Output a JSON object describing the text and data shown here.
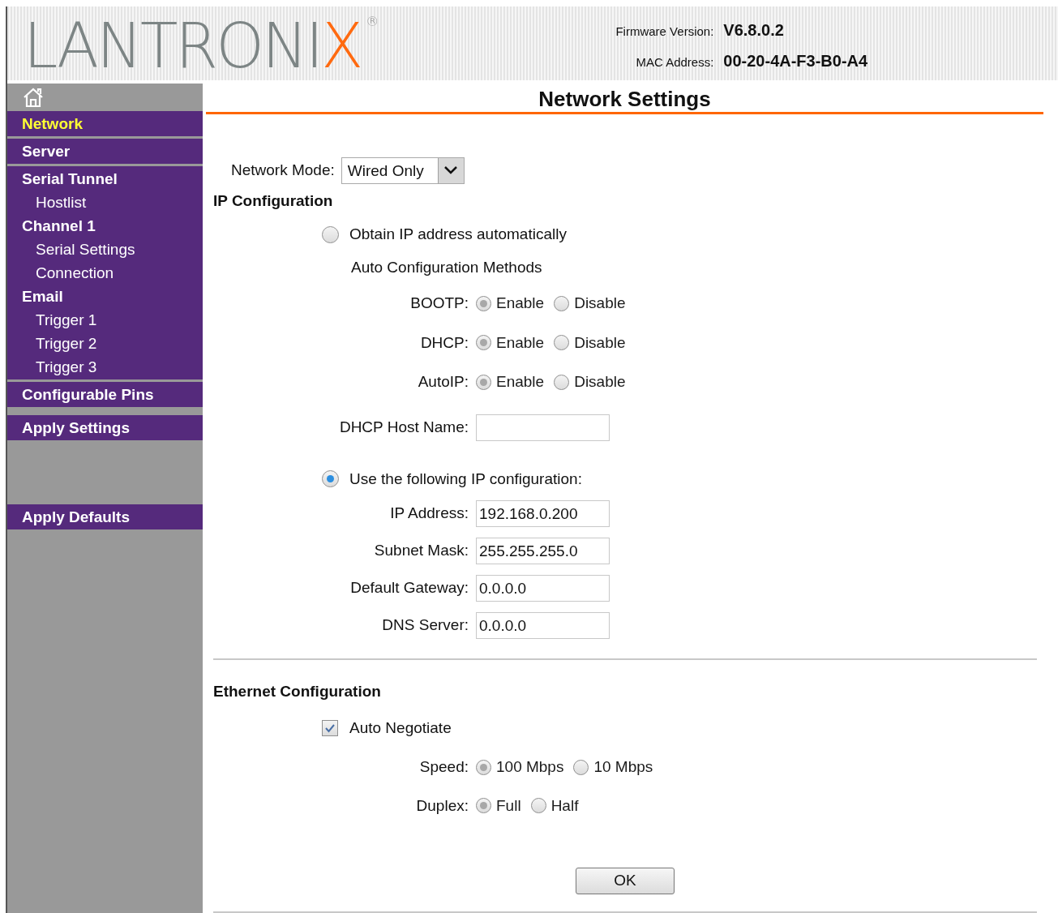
{
  "header": {
    "logo": {
      "main": "LANTRONI",
      "accent": "X",
      "mark": "®"
    },
    "info": [
      {
        "label": "Firmware Version:",
        "value": "V6.8.0.2"
      },
      {
        "label": "MAC Address:",
        "value": "00-20-4A-F3-B0-A4"
      }
    ]
  },
  "sidebar": {
    "groups": [
      {
        "items": [
          {
            "label": "Network",
            "selected": true
          }
        ]
      },
      {
        "items": [
          {
            "label": "Server",
            "selected": false
          }
        ]
      },
      {
        "items": [
          {
            "label": "Serial Tunnel",
            "selected": false,
            "children": [
              {
                "label": "Hostlist",
                "selected": false
              }
            ]
          },
          {
            "label": "Channel 1",
            "selected": false,
            "children": [
              {
                "label": "Serial Settings",
                "selected": false
              },
              {
                "label": "Connection",
                "selected": false
              }
            ]
          },
          {
            "label": "Email",
            "selected": false,
            "children": [
              {
                "label": "Trigger 1",
                "selected": false
              },
              {
                "label": "Trigger 2",
                "selected": false
              },
              {
                "label": "Trigger 3",
                "selected": false
              }
            ]
          }
        ]
      },
      {
        "items": [
          {
            "label": "Configurable Pins",
            "selected": false
          }
        ]
      },
      {
        "items": [
          {
            "label": "Apply Settings",
            "selected": false
          }
        ]
      },
      {
        "items": [
          {
            "label": "Apply Defaults",
            "selected": false
          }
        ]
      }
    ]
  },
  "title": "Network Settings",
  "network_mode": {
    "label": "Network Mode:",
    "value": "Wired Only"
  },
  "ip_config": {
    "heading": "IP Configuration",
    "auto": {
      "label": "Obtain IP address automatically",
      "selected": false,
      "methods_heading": "Auto Configuration Methods",
      "methods": [
        {
          "label": "BOOTP:",
          "disabled": true,
          "choices": [
            {
              "label": "Enable",
              "selected": true
            },
            {
              "label": "Disable",
              "selected": false
            }
          ]
        },
        {
          "label": "DHCP:",
          "disabled": true,
          "choices": [
            {
              "label": "Enable",
              "selected": true
            },
            {
              "label": "Disable",
              "selected": false
            }
          ]
        },
        {
          "label": "AutoIP:",
          "disabled": true,
          "choices": [
            {
              "label": "Enable",
              "selected": true
            },
            {
              "label": "Disable",
              "selected": false
            }
          ]
        }
      ],
      "host_name": {
        "label": "DHCP Host Name:"
      }
    },
    "manual": {
      "label": "Use the following IP configuration:",
      "selected": true,
      "fields": [
        {
          "label": "IP Address:",
          "value": "192.168.0.200"
        },
        {
          "label": "Subnet Mask:",
          "value": "255.255.255.0"
        },
        {
          "label": "Default Gateway:",
          "value": "0.0.0.0"
        },
        {
          "label": "DNS Server:",
          "value": "0.0.0.0"
        }
      ]
    }
  },
  "ethernet": {
    "heading": "Ethernet Configuration",
    "auto_negotiate": {
      "label": "Auto Negotiate",
      "checked": true
    },
    "settings": [
      {
        "label": "Speed:",
        "disabled": true,
        "choices": [
          {
            "label": "100 Mbps",
            "selected": true
          },
          {
            "label": "10 Mbps",
            "selected": false
          }
        ]
      },
      {
        "label": "Duplex:",
        "disabled": true,
        "choices": [
          {
            "label": "Full",
            "selected": true
          },
          {
            "label": "Half",
            "selected": false
          }
        ]
      }
    ]
  },
  "ok_button": "OK"
}
